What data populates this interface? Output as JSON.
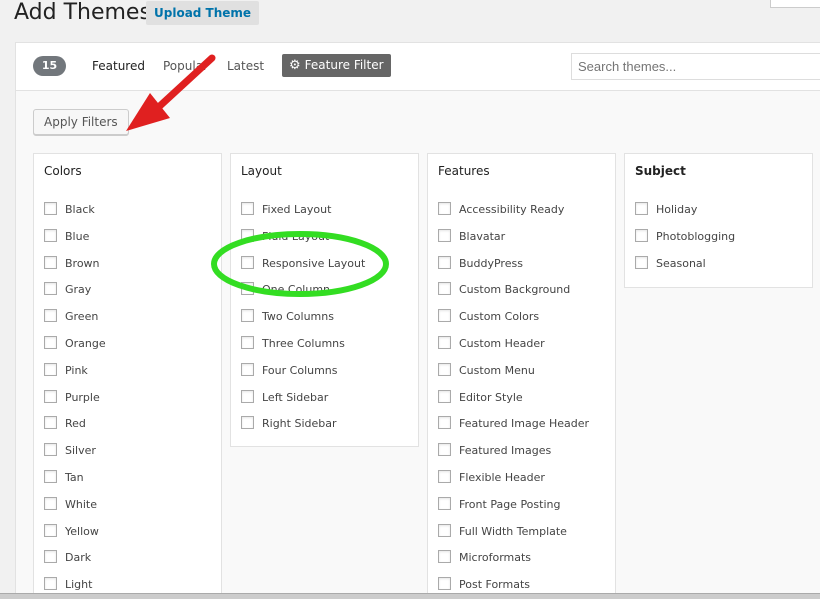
{
  "page": {
    "title": "Add Themes",
    "upload_label": "Upload Theme"
  },
  "filter_bar": {
    "count": "15",
    "tabs": [
      "Featured",
      "Popular",
      "Latest"
    ],
    "feature_filter_label": "Feature Filter",
    "search_placeholder": "Search themes..."
  },
  "apply_label": "Apply Filters",
  "groups": [
    {
      "title": "Colors",
      "items": [
        "Black",
        "Blue",
        "Brown",
        "Gray",
        "Green",
        "Orange",
        "Pink",
        "Purple",
        "Red",
        "Silver",
        "Tan",
        "White",
        "Yellow",
        "Dark",
        "Light"
      ]
    },
    {
      "title": "Layout",
      "items": [
        "Fixed Layout",
        "Fluid Layout",
        "Responsive Layout",
        "One Column",
        "Two Columns",
        "Three Columns",
        "Four Columns",
        "Left Sidebar",
        "Right Sidebar"
      ]
    },
    {
      "title": "Features",
      "items": [
        "Accessibility Ready",
        "Blavatar",
        "BuddyPress",
        "Custom Background",
        "Custom Colors",
        "Custom Header",
        "Custom Menu",
        "Editor Style",
        "Featured Image Header",
        "Featured Images",
        "Flexible Header",
        "Front Page Posting",
        "Full Width Template",
        "Microformats",
        "Post Formats"
      ]
    },
    {
      "title": "Subject",
      "items": [
        "Holiday",
        "Photoblogging",
        "Seasonal"
      ]
    }
  ],
  "colors": {
    "arrow": "#e02020",
    "highlight": "#33dd22",
    "link": "#0073aa"
  }
}
